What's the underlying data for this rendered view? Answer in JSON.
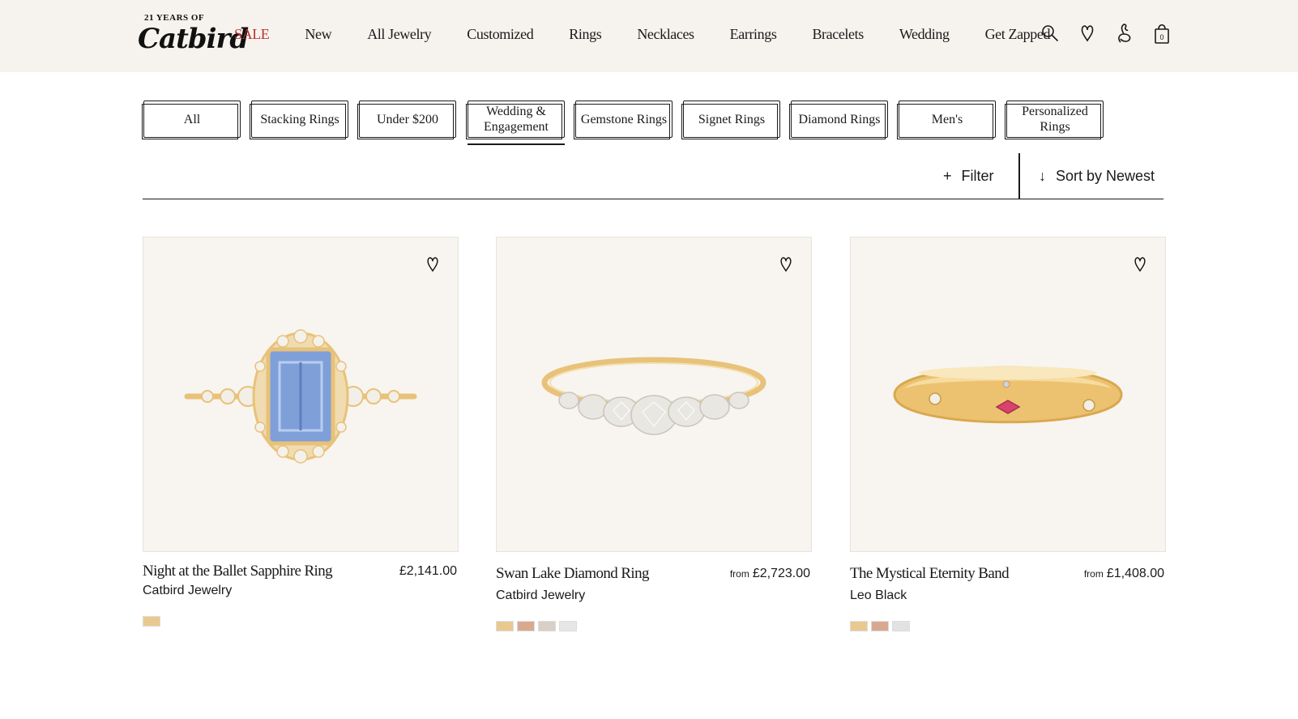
{
  "header": {
    "logo_top": "21 YEARS OF",
    "logo_main": "Catbird",
    "nav": [
      "SALE",
      "New",
      "All Jewelry",
      "Customized",
      "Rings",
      "Necklaces",
      "Earrings",
      "Bracelets",
      "Wedding",
      "Get Zapped"
    ],
    "sale_color": "#b8312f",
    "icons": [
      "search-icon",
      "heart-icon",
      "swan-icon",
      "bag-icon"
    ],
    "bag_count": "0"
  },
  "categories": [
    {
      "label": "All"
    },
    {
      "label": "Stacking Rings"
    },
    {
      "label": "Under $200"
    },
    {
      "label": "Wedding & Engagement"
    },
    {
      "label": "Gemstone Rings"
    },
    {
      "label": "Signet Rings"
    },
    {
      "label": "Diamond Rings"
    },
    {
      "label": "Men's"
    },
    {
      "label": "Personalized Rings"
    }
  ],
  "filter_bar": {
    "filter_label": "Filter",
    "filter_symbol": "+",
    "sort_label": "Sort by Newest",
    "sort_symbol": "↓"
  },
  "products": [
    {
      "name": "Night at the Ballet Sapphire Ring",
      "brand": "Catbird Jewelry",
      "from": "",
      "price": "£2,141.00",
      "swatches": [
        "#e9c98f"
      ],
      "image": "sapphire-ring"
    },
    {
      "name": "Swan Lake Diamond Ring",
      "brand": "Catbird Jewelry",
      "from": "from",
      "price": "£2,723.00",
      "swatches": [
        "#e9c98f",
        "#d9a98f",
        "#d8cfc6",
        "#e6e6e6"
      ],
      "image": "diamond-ring"
    },
    {
      "name": "The Mystical Eternity Band",
      "brand": "Leo Black",
      "from": "from",
      "price": "£1,408.00",
      "swatches": [
        "#e9c98f",
        "#d9a98f",
        "#e2e2e2"
      ],
      "image": "eternity-band"
    }
  ],
  "colors": {
    "header_bg": "#f6f3ee",
    "card_bg": "#f8f5f0",
    "gold": "#e8c27a",
    "sapphire": "#7f9fd8",
    "ruby": "#d9426b"
  }
}
